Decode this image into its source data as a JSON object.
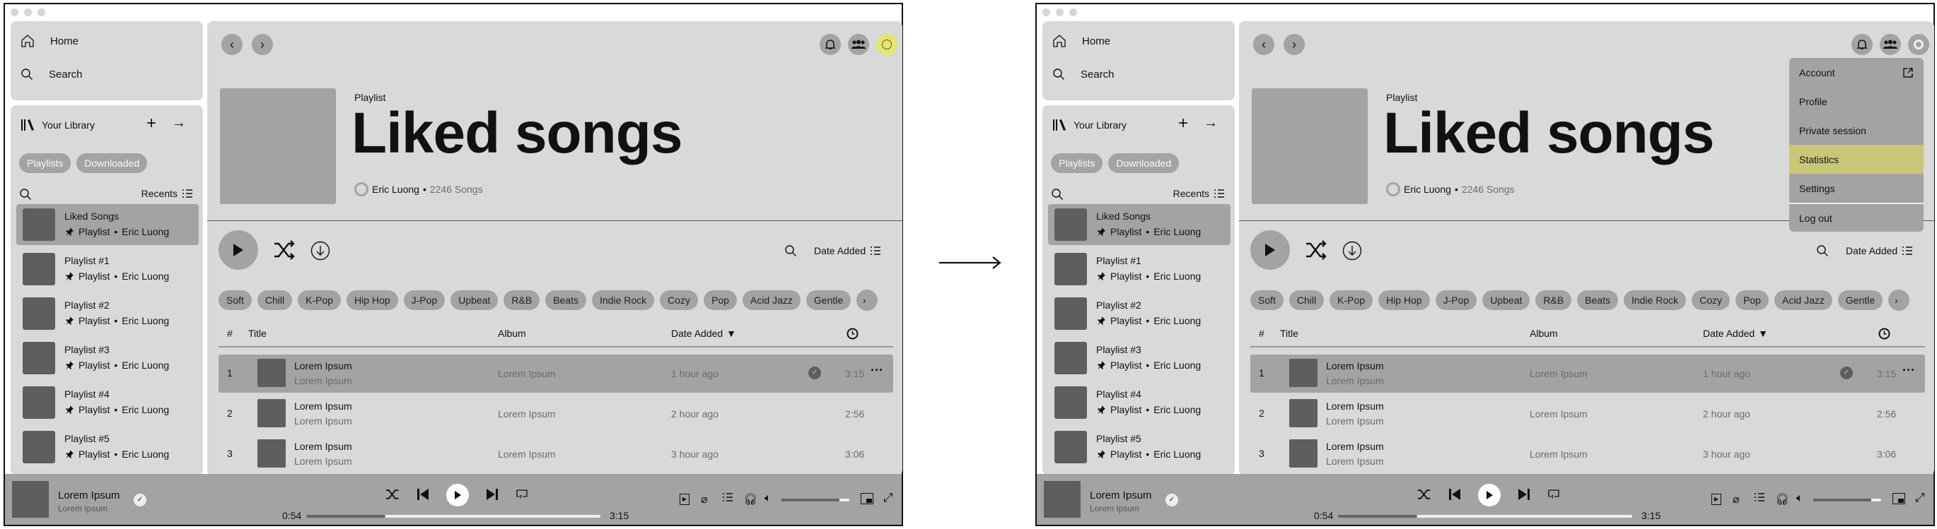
{
  "sidebar": {
    "home": "Home",
    "search": "Search",
    "library": "Your Library",
    "filters": [
      "Playlists",
      "Downloaded"
    ],
    "sort": "Recents",
    "items": [
      {
        "title": "Liked Songs",
        "type": "Playlist",
        "owner": "Eric Luong",
        "selected": true
      },
      {
        "title": "Playlist #1",
        "type": "Playlist",
        "owner": "Eric Luong"
      },
      {
        "title": "Playlist #2",
        "type": "Playlist",
        "owner": "Eric Luong"
      },
      {
        "title": "Playlist #3",
        "type": "Playlist",
        "owner": "Eric Luong"
      },
      {
        "title": "Playlist #4",
        "type": "Playlist",
        "owner": "Eric Luong"
      },
      {
        "title": "Playlist #5",
        "type": "Playlist",
        "owner": "Eric Luong"
      }
    ]
  },
  "header": {
    "type_label": "Playlist",
    "title": "Liked songs",
    "owner": "Eric Luong",
    "separator": "•",
    "count": "2246 Songs"
  },
  "toolbar": {
    "sort": "Date Added"
  },
  "genres": [
    "Soft",
    "Chill",
    "K-Pop",
    "Hip Hop",
    "J-Pop",
    "Upbeat",
    "R&B",
    "Beats",
    "Indie Rock",
    "Cozy",
    "Pop",
    "Acid Jazz",
    "Gentle"
  ],
  "table": {
    "columns": [
      "#",
      "Title",
      "Album",
      "Date Added"
    ],
    "rows": [
      {
        "n": "1",
        "title": "Lorem Ipsum",
        "artist": "Lorem Ipsum",
        "album": "Lorem Ipsum",
        "added": "1 hour ago",
        "duration": "3:15",
        "selected": true
      },
      {
        "n": "2",
        "title": "Lorem Ipsum",
        "artist": "Lorem Ipsum",
        "album": "Lorem Ipsum",
        "added": "2 hour ago",
        "duration": "2:56"
      },
      {
        "n": "3",
        "title": "Lorem Ipsum",
        "artist": "Lorem Ipsum",
        "album": "Lorem Ipsum",
        "added": "3 hour ago",
        "duration": "3:06"
      }
    ]
  },
  "player": {
    "title": "Lorem Ipsum",
    "artist": "Lorem Ipsum",
    "elapsed": "0:54",
    "total": "3:15",
    "progress": 0.27,
    "volume": 0.85
  },
  "menu": {
    "items": [
      "Account",
      "Profile",
      "Private session",
      "Statistics",
      "Settings",
      "Log out"
    ],
    "highlighted": "Statistics"
  },
  "colors": {
    "avatar_active": "#e6e66a",
    "highlight": "#c9c677",
    "panel": "#d9d9d9",
    "control": "#a3a3a3"
  }
}
